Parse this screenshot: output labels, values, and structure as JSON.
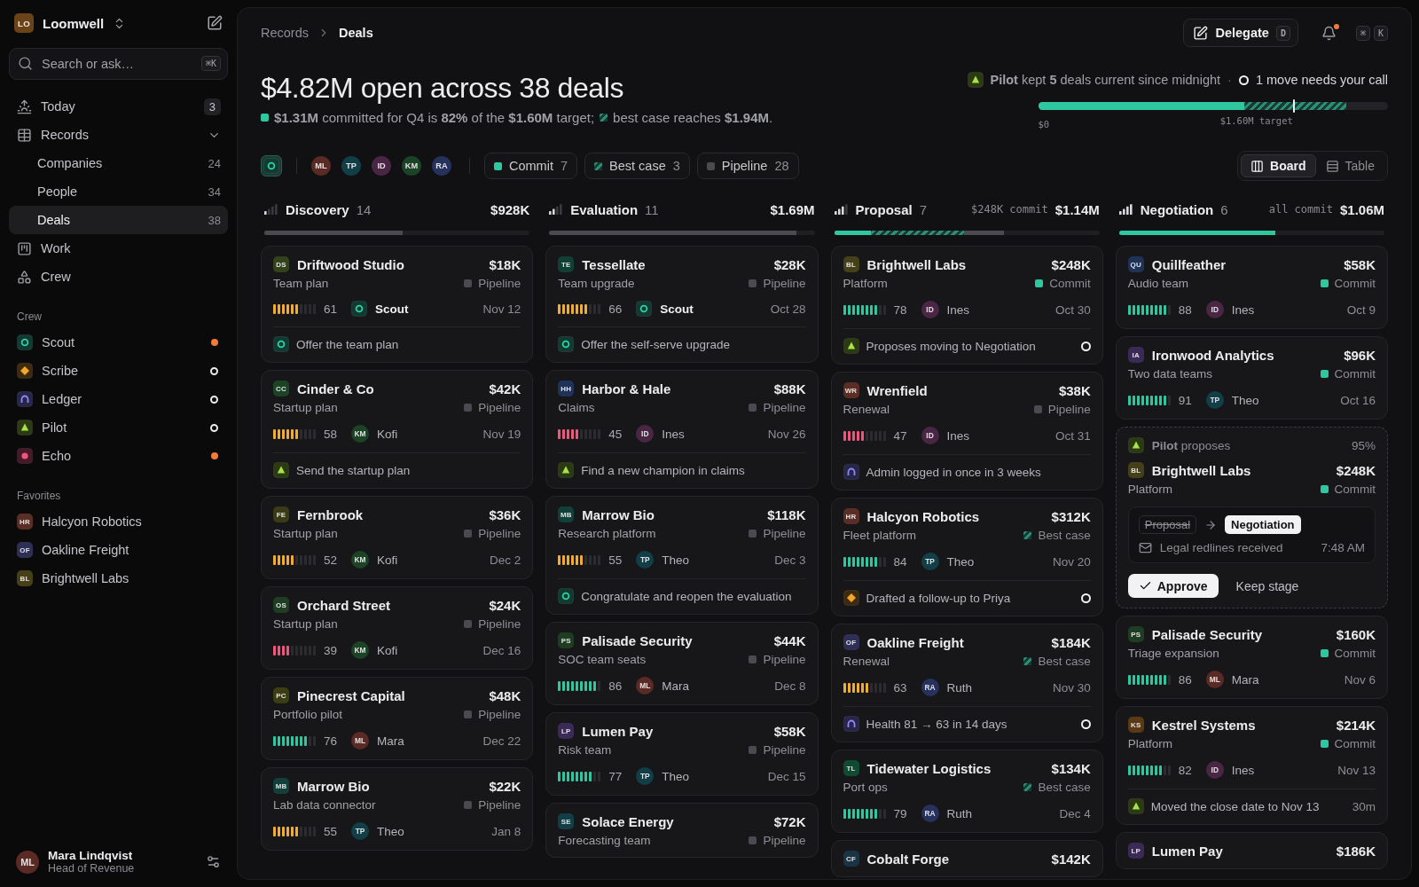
{
  "sidebar": {
    "workspace": {
      "initials": "LO",
      "name": "Loomwell"
    },
    "search": {
      "placeholder": "Search or ask…",
      "shortcut": "⌘K"
    },
    "nav": [
      {
        "label": "Today",
        "count": "3",
        "selected": false
      },
      {
        "label": "Records",
        "expanded": true,
        "selected": false,
        "children": [
          {
            "label": "Companies",
            "count": "24",
            "selected": false
          },
          {
            "label": "People",
            "count": "34",
            "selected": false
          },
          {
            "label": "Deals",
            "count": "38",
            "selected": true
          }
        ]
      },
      {
        "label": "Work",
        "selected": false
      },
      {
        "label": "Crew",
        "selected": false
      }
    ],
    "crew": {
      "title": "Crew",
      "items": [
        {
          "name": "Scout",
          "kind": "scout",
          "busy": true
        },
        {
          "name": "Scribe",
          "kind": "scribe",
          "busy": false
        },
        {
          "name": "Ledger",
          "kind": "ledger",
          "busy": false
        },
        {
          "name": "Pilot",
          "kind": "pilot",
          "busy": false
        },
        {
          "name": "Echo",
          "kind": "echo",
          "busy": true
        }
      ]
    },
    "favorites": {
      "title": "Favorites",
      "items": [
        {
          "initials": "HR",
          "name": "Halcyon Robotics",
          "color": "#5a2e24"
        },
        {
          "initials": "OF",
          "name": "Oakline Freight",
          "color": "#2f2f55"
        },
        {
          "initials": "BL",
          "name": "Brightwell Labs",
          "color": "#45401a"
        }
      ]
    },
    "user": {
      "initials": "ML",
      "name": "Mara Lindqvist",
      "role": "Head of Revenue",
      "color": "#5a2a24"
    }
  },
  "header": {
    "breadcrumb": [
      "Records",
      "Deals"
    ],
    "delegate": {
      "label": "Delegate",
      "shortcut": "D"
    },
    "notifications": {
      "unread": true
    },
    "command_keys": [
      "⌘",
      "K"
    ]
  },
  "summary": {
    "headline": "$4.82M open across 38 deals",
    "commit_text": "**$1.31M** committed for Q4 is **82%** of the **$1.60M** target;",
    "best_case_text": "best case reaches **$1.94M**.",
    "pilot_status": {
      "kind": "pilot",
      "text": "**Pilot** kept **5** deals current since midnight",
      "separator": "·",
      "pending_text": "1 move needs your call"
    },
    "target_bar": {
      "fills": [
        {
          "kind": "best_case",
          "level": 0.88
        },
        {
          "kind": "commit",
          "level": 0.59
        }
      ],
      "marker": {
        "level": 0.73
      },
      "start_label": "$0",
      "target_label": "$1.60M target"
    }
  },
  "filters": {
    "agent": {
      "kind": "scout",
      "selected": true
    },
    "owners": [
      {
        "initials": "ML",
        "color": "#5a2a24",
        "selected": false
      },
      {
        "initials": "TP",
        "color": "#123f47",
        "selected": false
      },
      {
        "initials": "ID",
        "color": "#4a2645",
        "selected": false
      },
      {
        "initials": "KM",
        "color": "#1d4326",
        "selected": false
      },
      {
        "initials": "RA",
        "color": "#26315c",
        "selected": false
      }
    ],
    "forecast": [
      {
        "kind": "commit",
        "label": "Commit",
        "count": "7"
      },
      {
        "kind": "best_case",
        "label": "Best case",
        "count": "3"
      },
      {
        "kind": "pipeline",
        "label": "Pipeline",
        "count": "28"
      }
    ],
    "views": [
      {
        "label": "Board",
        "selected": true
      },
      {
        "label": "Table",
        "selected": false
      }
    ]
  },
  "columns": [
    {
      "name": "Discovery",
      "count": "14",
      "total": "$928K",
      "fills": [
        {
          "kind": "pipeline",
          "level": 0.52
        }
      ],
      "cards": [
        {
          "kind": "deal",
          "initials": "DS",
          "color": "#34421c",
          "name": "Driftwood Studio",
          "amount": "$18K",
          "plan": "Team plan",
          "forecast": {
            "kind": "pipeline",
            "label": "Pipeline"
          },
          "meta": {
            "level": 0.61,
            "score": "61",
            "owner": {
              "kind": "scout",
              "name": "Scout"
            },
            "date": "Nov 12"
          },
          "note": {
            "kind": "scout",
            "text": "Offer the team plan"
          }
        },
        {
          "kind": "deal",
          "initials": "CC",
          "color": "#1d4326",
          "name": "Cinder & Co",
          "amount": "$42K",
          "plan": "Startup plan",
          "forecast": {
            "kind": "pipeline",
            "label": "Pipeline"
          },
          "meta": {
            "level": 0.58,
            "score": "58",
            "owner": {
              "kind": "person",
              "initials": "KM",
              "name": "Kofi",
              "color": "#1d4326"
            },
            "date": "Nov 19"
          },
          "note": {
            "kind": "pilot",
            "text": "Send the startup plan"
          }
        },
        {
          "kind": "deal",
          "initials": "FE",
          "color": "#3a3a16",
          "name": "Fernbrook",
          "amount": "$36K",
          "plan": "Startup plan",
          "forecast": {
            "kind": "pipeline",
            "label": "Pipeline"
          },
          "meta": {
            "level": 0.52,
            "score": "52",
            "owner": {
              "kind": "person",
              "initials": "KM",
              "name": "Kofi",
              "color": "#1d4326"
            },
            "date": "Dec 2"
          }
        },
        {
          "kind": "deal",
          "initials": "OS",
          "color": "#1e3d22",
          "name": "Orchard Street",
          "amount": "$24K",
          "plan": "Startup plan",
          "forecast": {
            "kind": "pipeline",
            "label": "Pipeline"
          },
          "meta": {
            "level": 0.39,
            "score": "39",
            "owner": {
              "kind": "person",
              "initials": "KM",
              "name": "Kofi",
              "color": "#1d4326"
            },
            "date": "Dec 16"
          }
        },
        {
          "kind": "deal",
          "initials": "PC",
          "color": "#3d3d14",
          "name": "Pinecrest Capital",
          "amount": "$48K",
          "plan": "Portfolio pilot",
          "forecast": {
            "kind": "pipeline",
            "label": "Pipeline"
          },
          "meta": {
            "level": 0.76,
            "score": "76",
            "owner": {
              "kind": "person",
              "initials": "ML",
              "name": "Mara",
              "color": "#5a2a24"
            },
            "date": "Dec 22"
          }
        },
        {
          "kind": "deal",
          "initials": "MB",
          "color": "#123f3a",
          "name": "Marrow Bio",
          "amount": "$22K",
          "plan": "Lab data connector",
          "forecast": {
            "kind": "pipeline",
            "label": "Pipeline"
          },
          "meta": {
            "level": 0.55,
            "score": "55",
            "owner": {
              "kind": "person",
              "initials": "TP",
              "name": "Theo",
              "color": "#123f47"
            },
            "date": "Jan 8"
          }
        }
      ]
    },
    {
      "name": "Evaluation",
      "count": "11",
      "total": "$1.69M",
      "fills": [
        {
          "kind": "pipeline",
          "level": 0.93
        }
      ],
      "cards": [
        {
          "kind": "deal",
          "initials": "TE",
          "color": "#123f33",
          "name": "Tessellate",
          "amount": "$28K",
          "plan": "Team upgrade",
          "forecast": {
            "kind": "pipeline",
            "label": "Pipeline"
          },
          "meta": {
            "level": 0.66,
            "score": "66",
            "owner": {
              "kind": "scout",
              "name": "Scout"
            },
            "date": "Oct 28"
          },
          "note": {
            "kind": "scout",
            "text": "Offer the self-serve upgrade"
          }
        },
        {
          "kind": "deal",
          "initials": "HH",
          "color": "#1f3358",
          "name": "Harbor & Hale",
          "amount": "$88K",
          "plan": "Claims",
          "forecast": {
            "kind": "pipeline",
            "label": "Pipeline"
          },
          "meta": {
            "level": 0.45,
            "score": "45",
            "owner": {
              "kind": "person",
              "initials": "ID",
              "name": "Ines",
              "color": "#4a2645"
            },
            "date": "Nov 26"
          },
          "note": {
            "kind": "pilot",
            "text": "Find a new champion in claims"
          }
        },
        {
          "kind": "deal",
          "initials": "MB",
          "color": "#123f3a",
          "name": "Marrow Bio",
          "amount": "$118K",
          "plan": "Research platform",
          "forecast": {
            "kind": "pipeline",
            "label": "Pipeline"
          },
          "meta": {
            "level": 0.55,
            "score": "55",
            "owner": {
              "kind": "person",
              "initials": "TP",
              "name": "Theo",
              "color": "#123f47"
            },
            "date": "Dec 3"
          },
          "note": {
            "kind": "scout",
            "text": "Congratulate and reopen the evaluation"
          }
        },
        {
          "kind": "deal",
          "initials": "PS",
          "color": "#1e3d22",
          "name": "Palisade Security",
          "amount": "$44K",
          "plan": "SOC team seats",
          "forecast": {
            "kind": "pipeline",
            "label": "Pipeline"
          },
          "meta": {
            "level": 0.86,
            "score": "86",
            "owner": {
              "kind": "person",
              "initials": "ML",
              "name": "Mara",
              "color": "#5a2a24"
            },
            "date": "Dec 8"
          }
        },
        {
          "kind": "deal",
          "initials": "LP",
          "color": "#3a2a55",
          "name": "Lumen Pay",
          "amount": "$58K",
          "plan": "Risk team",
          "forecast": {
            "kind": "pipeline",
            "label": "Pipeline"
          },
          "meta": {
            "level": 0.77,
            "score": "77",
            "owner": {
              "kind": "person",
              "initials": "TP",
              "name": "Theo",
              "color": "#123f47"
            },
            "date": "Dec 15"
          }
        },
        {
          "kind": "deal",
          "initials": "SE",
          "color": "#123f47",
          "name": "Solace Energy",
          "amount": "$72K",
          "plan": "Forecasting team",
          "forecast": {
            "kind": "pipeline",
            "label": "Pipeline"
          }
        }
      ]
    },
    {
      "name": "Proposal",
      "count": "7",
      "extra": "$248K commit",
      "total": "$1.14M",
      "fills": [
        {
          "kind": "pipeline",
          "level": 0.64
        },
        {
          "kind": "best_case",
          "level": 0.49
        },
        {
          "kind": "commit",
          "level": 0.14
        }
      ],
      "cards": [
        {
          "kind": "deal",
          "initials": "BL",
          "color": "#45401a",
          "name": "Brightwell Labs",
          "amount": "$248K",
          "plan": "Platform",
          "forecast": {
            "kind": "commit",
            "label": "Commit"
          },
          "meta": {
            "level": 0.78,
            "score": "78",
            "owner": {
              "kind": "person",
              "initials": "ID",
              "name": "Ines",
              "color": "#4a2645"
            },
            "date": "Oct 30"
          },
          "note": {
            "kind": "pilot",
            "text": "Proposes moving to Negotiation",
            "pending": true
          }
        },
        {
          "kind": "deal",
          "initials": "WR",
          "color": "#5a2e24",
          "name": "Wrenfield",
          "amount": "$38K",
          "plan": "Renewal",
          "forecast": {
            "kind": "pipeline",
            "label": "Pipeline"
          },
          "meta": {
            "level": 0.47,
            "score": "47",
            "owner": {
              "kind": "person",
              "initials": "ID",
              "name": "Ines",
              "color": "#4a2645"
            },
            "date": "Oct 31"
          },
          "note": {
            "kind": "ledger",
            "text": "Admin logged in once in 3 weeks"
          }
        },
        {
          "kind": "deal",
          "initials": "HR",
          "color": "#5a2e24",
          "name": "Halcyon Robotics",
          "amount": "$312K",
          "plan": "Fleet platform",
          "forecast": {
            "kind": "best_case",
            "label": "Best case"
          },
          "meta": {
            "level": 0.84,
            "score": "84",
            "owner": {
              "kind": "person",
              "initials": "TP",
              "name": "Theo",
              "color": "#123f47"
            },
            "date": "Nov 20"
          },
          "note": {
            "kind": "scribe",
            "text": "Drafted a follow-up to Priya",
            "pending": true
          }
        },
        {
          "kind": "deal",
          "initials": "OF",
          "color": "#2f2f55",
          "name": "Oakline Freight",
          "amount": "$184K",
          "plan": "Renewal",
          "forecast": {
            "kind": "best_case",
            "label": "Best case"
          },
          "meta": {
            "level": 0.63,
            "score": "63",
            "owner": {
              "kind": "person",
              "initials": "RA",
              "name": "Ruth",
              "color": "#26315c"
            },
            "date": "Nov 30"
          },
          "note": {
            "kind": "ledger",
            "text": "Health 81 → 63 in 14 days",
            "pending": true
          }
        },
        {
          "kind": "deal",
          "initials": "TL",
          "color": "#114a33",
          "name": "Tidewater Logistics",
          "amount": "$134K",
          "plan": "Port ops",
          "forecast": {
            "kind": "best_case",
            "label": "Best case"
          },
          "meta": {
            "level": 0.79,
            "score": "79",
            "owner": {
              "kind": "person",
              "initials": "RA",
              "name": "Ruth",
              "color": "#26315c"
            },
            "date": "Dec 4"
          }
        },
        {
          "kind": "deal",
          "initials": "CF",
          "color": "#1c3344",
          "name": "Cobalt Forge",
          "amount": "$142K"
        }
      ]
    },
    {
      "name": "Negotiation",
      "count": "6",
      "extra": "all commit",
      "total": "$1.06M",
      "fills": [
        {
          "kind": "commit",
          "level": 0.59
        }
      ],
      "cards": [
        {
          "kind": "deal",
          "initials": "QU",
          "color": "#1f3358",
          "name": "Quillfeather",
          "amount": "$58K",
          "plan": "Audio team",
          "forecast": {
            "kind": "commit",
            "label": "Commit"
          },
          "meta": {
            "level": 0.88,
            "score": "88",
            "owner": {
              "kind": "person",
              "initials": "ID",
              "name": "Ines",
              "color": "#4a2645"
            },
            "date": "Oct 9"
          }
        },
        {
          "kind": "deal",
          "initials": "IA",
          "color": "#3a2a55",
          "name": "Ironwood Analytics",
          "amount": "$96K",
          "plan": "Two data teams",
          "forecast": {
            "kind": "commit",
            "label": "Commit"
          },
          "meta": {
            "level": 0.91,
            "score": "91",
            "owner": {
              "kind": "person",
              "initials": "TP",
              "name": "Theo",
              "color": "#123f47"
            },
            "date": "Oct 16"
          }
        },
        {
          "kind": "proposal",
          "agent": {
            "kind": "pilot"
          },
          "title": "**Pilot** proposes",
          "confidence": "95%",
          "deal": {
            "initials": "BL",
            "color": "#45401a",
            "name": "Brightwell Labs",
            "amount": "$248K",
            "plan": "Platform",
            "forecast": {
              "kind": "commit",
              "label": "Commit"
            }
          },
          "from_stage": "Proposal",
          "to_stage": "Negotiation",
          "evidence": "Legal redlines received",
          "time": "7:48 AM",
          "approve": "Approve",
          "dismiss": "Keep stage"
        },
        {
          "kind": "deal",
          "initials": "PS",
          "color": "#1e3d22",
          "name": "Palisade Security",
          "amount": "$160K",
          "plan": "Triage expansion",
          "forecast": {
            "kind": "commit",
            "label": "Commit"
          },
          "meta": {
            "level": 0.86,
            "score": "86",
            "owner": {
              "kind": "person",
              "initials": "ML",
              "name": "Mara",
              "color": "#5a2a24"
            },
            "date": "Nov 6"
          }
        },
        {
          "kind": "deal",
          "initials": "KS",
          "color": "#5a3a14",
          "name": "Kestrel Systems",
          "amount": "$214K",
          "plan": "Platform",
          "forecast": {
            "kind": "commit",
            "label": "Commit"
          },
          "meta": {
            "level": 0.82,
            "score": "82",
            "owner": {
              "kind": "person",
              "initials": "ID",
              "name": "Ines",
              "color": "#4a2645"
            },
            "date": "Nov 13"
          },
          "note": {
            "kind": "pilot",
            "text": "Moved the close date to Nov 13",
            "time": "30m"
          }
        },
        {
          "kind": "deal",
          "initials": "LP",
          "color": "#3a2a55",
          "name": "Lumen Pay",
          "amount": "$186K"
        }
      ]
    }
  ]
}
